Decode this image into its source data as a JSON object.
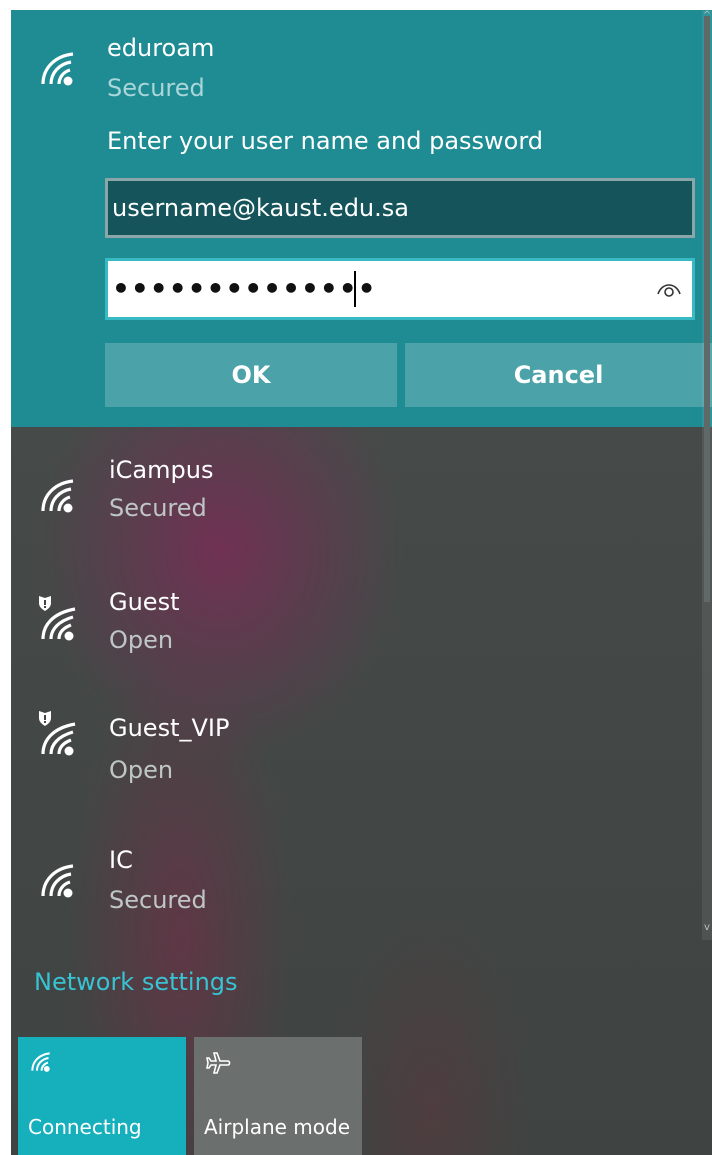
{
  "active_network": {
    "name": "eduroam",
    "status": "Secured",
    "prompt": "Enter your user name and password",
    "username_value": "username@kaust.edu.sa",
    "password_mask": "••••••••••••••",
    "ok_label": "OK",
    "cancel_label": "Cancel"
  },
  "networks": [
    {
      "name": "iCampus",
      "status": "Secured",
      "icon": "wifi-signal-icon"
    },
    {
      "name": "Guest",
      "status": "Open",
      "icon": "wifi-shield-icon"
    },
    {
      "name": "Guest_VIP",
      "status": "Open",
      "icon": "wifi-shield-icon"
    },
    {
      "name": "IC",
      "status": "Secured",
      "icon": "wifi-signal-icon"
    }
  ],
  "settings_link": "Network settings",
  "tiles": [
    {
      "label": "Connecting",
      "icon": "wifi-icon",
      "active": true
    },
    {
      "label": "Airplane mode",
      "icon": "airplane-icon",
      "active": false
    }
  ],
  "colors": {
    "accent": "#1f8b93",
    "tile_active": "#16b0bd",
    "link": "#38c3d3"
  }
}
